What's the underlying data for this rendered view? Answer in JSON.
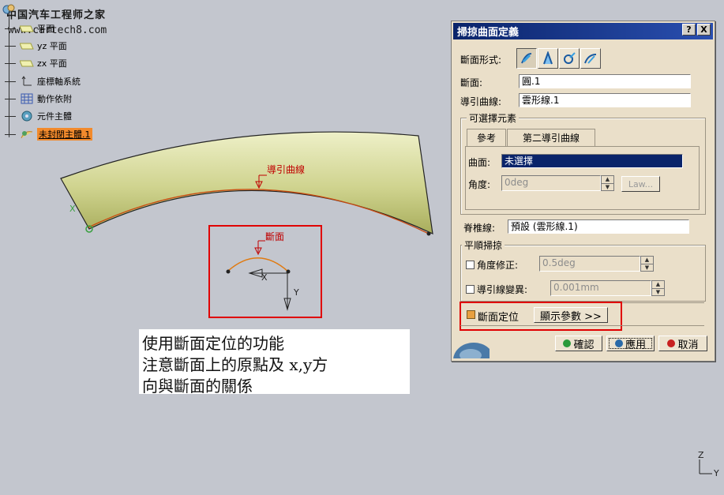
{
  "watermark": {
    "title": "中国汽车工程师之家",
    "url": "www.cartech8.com"
  },
  "tree": {
    "items": [
      {
        "label": "平面"
      },
      {
        "label": "yz 平面"
      },
      {
        "label": "zx 平面"
      },
      {
        "label": "座標軸系統"
      },
      {
        "label": "動作依附"
      },
      {
        "label": "元件主體"
      },
      {
        "label": "未封閉主體.1"
      }
    ]
  },
  "viewport": {
    "guide_label": "導引曲線",
    "section_label": "斷面",
    "x_axis": "X",
    "y_axis": "Y",
    "note_lines": [
      "使用斷面定位的功能",
      "注意斷面上的原點及  x,y方",
      "向與斷面的關係"
    ],
    "compass": {
      "z": "Z",
      "y": "Y"
    }
  },
  "dialog": {
    "title": "掃掠曲面定義",
    "help_btn": "?",
    "close_btn": "X",
    "profile_type_label": "斷面形式:",
    "profile_label": "斷面:",
    "profile_value": "圓.1",
    "guide_label": "導引曲線:",
    "guide_value": "雲形線.1",
    "optional_group": "可選擇元素",
    "tabs": [
      "參考",
      "第二導引曲線"
    ],
    "surface_label": "曲面:",
    "surface_value": "未選擇",
    "angle_label": "角度:",
    "angle_value": "0deg",
    "law_btn": "Law...",
    "spine_label": "脊椎線:",
    "spine_value": "預設 (雲形線.1)",
    "smooth_group": "平順掃掠",
    "angle_corr_label": "角度修正:",
    "angle_corr_value": "0.5deg",
    "deviation_label": "導引線變異:",
    "deviation_value": "0.001mm",
    "positioning_label": "斷面定位",
    "show_params_btn": "顯示參數 >>",
    "ok_btn": "確認",
    "apply_btn": "應用",
    "cancel_btn": "取消"
  },
  "colors": {
    "surface": "#d8dba0",
    "title_bar": "#0a246a",
    "highlight_box": "#e00000",
    "tree_highlight": "#f28a2c"
  }
}
